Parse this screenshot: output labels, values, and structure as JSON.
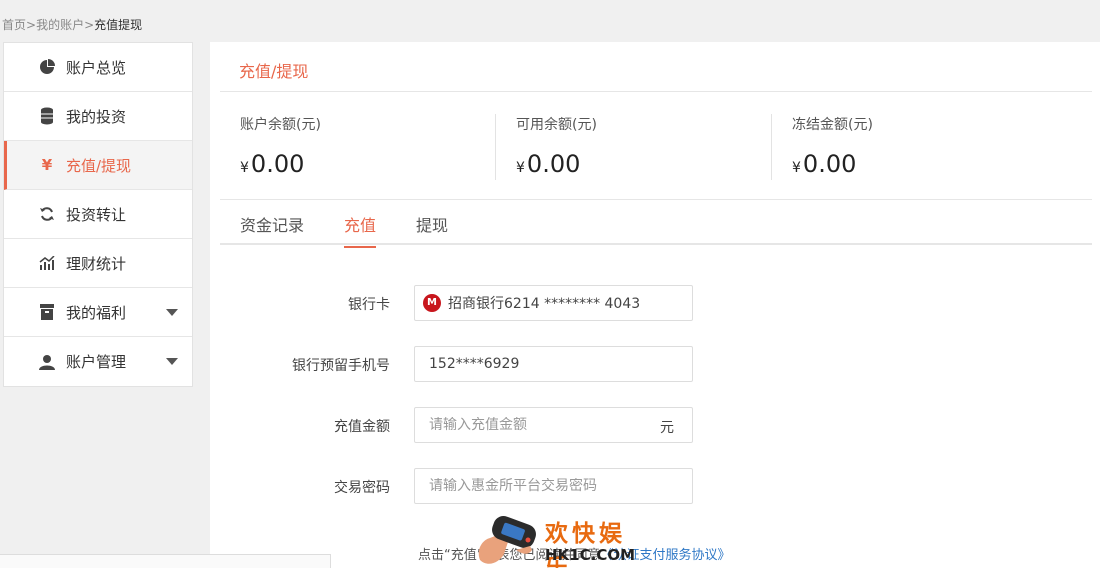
{
  "breadcrumb": {
    "home": "首页",
    "sep1": ">",
    "account": "我的账户",
    "sep2": ">",
    "current": "充值提现"
  },
  "sidebar": {
    "items": [
      {
        "label": "账户总览",
        "icon": "pie-chart-icon"
      },
      {
        "label": "我的投资",
        "icon": "coin-stack-icon"
      },
      {
        "label": "充值/提现",
        "icon": "yen-icon",
        "active": true
      },
      {
        "label": "投资转让",
        "icon": "refresh-icon"
      },
      {
        "label": "理财统计",
        "icon": "chart-icon"
      },
      {
        "label": "我的福利",
        "icon": "gift-box-icon",
        "expandable": true
      },
      {
        "label": "账户管理",
        "icon": "user-icon",
        "expandable": true
      }
    ]
  },
  "panel": {
    "title": "充值/提现"
  },
  "balances": [
    {
      "label": "账户余额(元)",
      "currency": "¥",
      "amount": "0.00"
    },
    {
      "label": "可用余额(元)",
      "currency": "¥",
      "amount": "0.00"
    },
    {
      "label": "冻结金额(元)",
      "currency": "¥",
      "amount": "0.00"
    }
  ],
  "tabs": [
    {
      "label": "资金记录"
    },
    {
      "label": "充值",
      "active": true
    },
    {
      "label": "提现"
    }
  ],
  "form": {
    "bank_card_label": "银行卡",
    "bank_card_value": "招商银行6214 ******** 4043",
    "phone_label": "银行预留手机号",
    "phone_value": "152****6929",
    "amount_label": "充值金额",
    "amount_placeholder": "请输入充值金额",
    "amount_unit": "元",
    "password_label": "交易密码",
    "password_placeholder": "请输入惠金所平台交易密码"
  },
  "agreement": {
    "prefix": "点击“充值”代表您已阅读并同意",
    "link": "《认证支付服务协议》"
  },
  "watermark": {
    "title": "欢快娱乐",
    "site": "HK1C.COM"
  },
  "colors": {
    "accent": "#e8674b",
    "link": "#2f78c6",
    "bank_red": "#c8161d"
  }
}
